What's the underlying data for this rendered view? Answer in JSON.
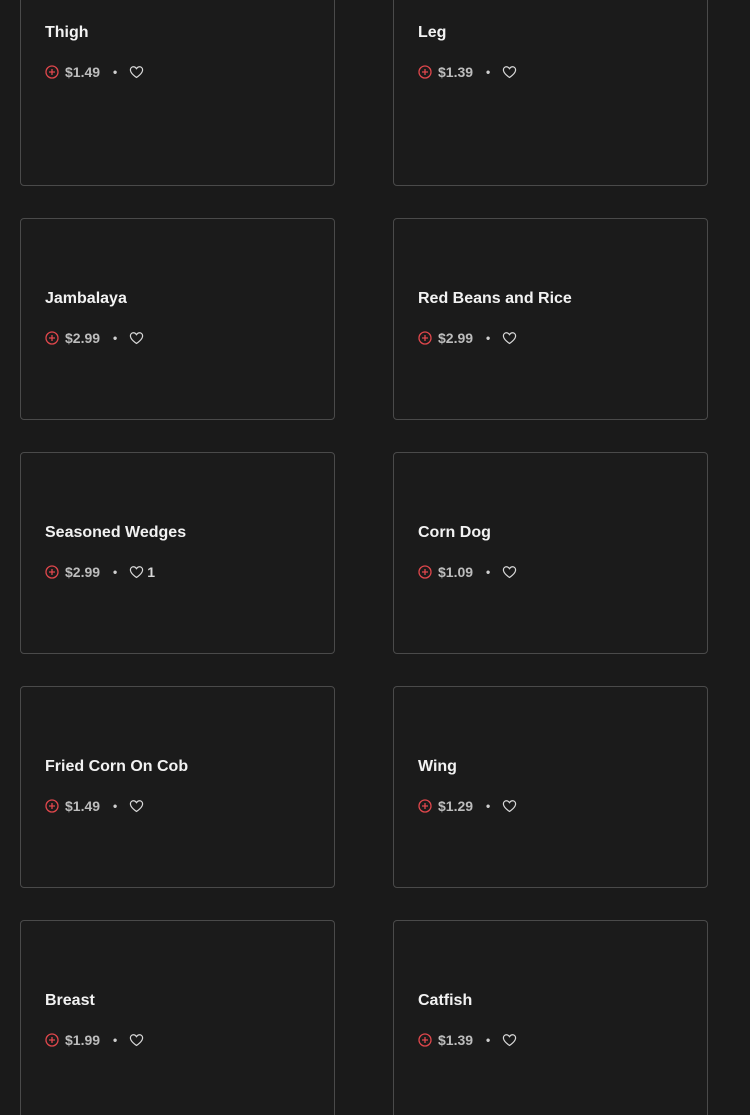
{
  "colors": {
    "background": "#1a1a1a",
    "card_border": "#4a4a4a",
    "accent": "#e0474c",
    "text": "#f2f2f2",
    "muted": "#bdbdbd"
  },
  "icons": {
    "add": "plus-circle-icon",
    "favorite": "heart-icon"
  },
  "separator": "•",
  "items": [
    {
      "name": "Thigh",
      "price": "$1.49",
      "favorites": ""
    },
    {
      "name": "Leg",
      "price": "$1.39",
      "favorites": ""
    },
    {
      "name": "Jambalaya",
      "price": "$2.99",
      "favorites": ""
    },
    {
      "name": "Red Beans and Rice",
      "price": "$2.99",
      "favorites": ""
    },
    {
      "name": "Seasoned Wedges",
      "price": "$2.99",
      "favorites": "1"
    },
    {
      "name": "Corn Dog",
      "price": "$1.09",
      "favorites": ""
    },
    {
      "name": "Fried Corn On Cob",
      "price": "$1.49",
      "favorites": ""
    },
    {
      "name": "Wing",
      "price": "$1.29",
      "favorites": ""
    },
    {
      "name": "Breast",
      "price": "$1.99",
      "favorites": ""
    },
    {
      "name": "Catfish",
      "price": "$1.39",
      "favorites": ""
    }
  ]
}
